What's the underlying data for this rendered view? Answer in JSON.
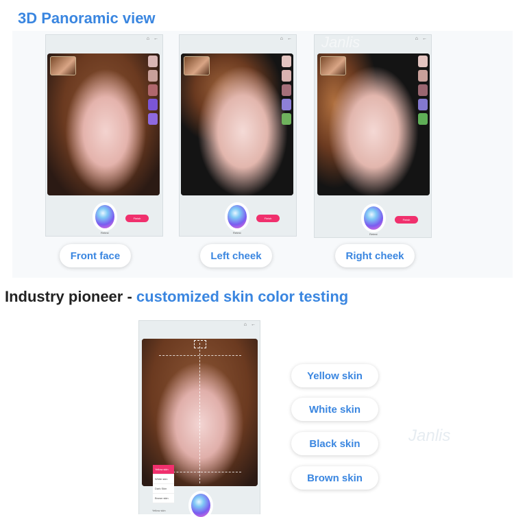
{
  "section1": {
    "title": "3D Panoramic view"
  },
  "section2": {
    "title_prefix": "Industry pioneer - ",
    "title_highlight": "customized skin color testing"
  },
  "views": [
    {
      "label": "Front face",
      "orb_label": "Retest",
      "button_label": "Finish"
    },
    {
      "label": "Left cheek",
      "orb_label": "Retest",
      "button_label": "Finish"
    },
    {
      "label": "Right cheek",
      "orb_label": "Retest",
      "button_label": "Finish"
    }
  ],
  "skin_options": [
    "Yellow skin",
    "White skin",
    "Black skin",
    "Brown skin"
  ],
  "skin_menu": [
    "Yellow skin",
    "White skin",
    "Dark Skin",
    "Brown skin"
  ],
  "skin_selector_label": "Yellow skin",
  "watermark": "Janlis",
  "colors": {
    "accent_blue": "#3a86e0",
    "button_pink": "#f0306d"
  },
  "icons": [
    "home-icon",
    "back-icon"
  ]
}
